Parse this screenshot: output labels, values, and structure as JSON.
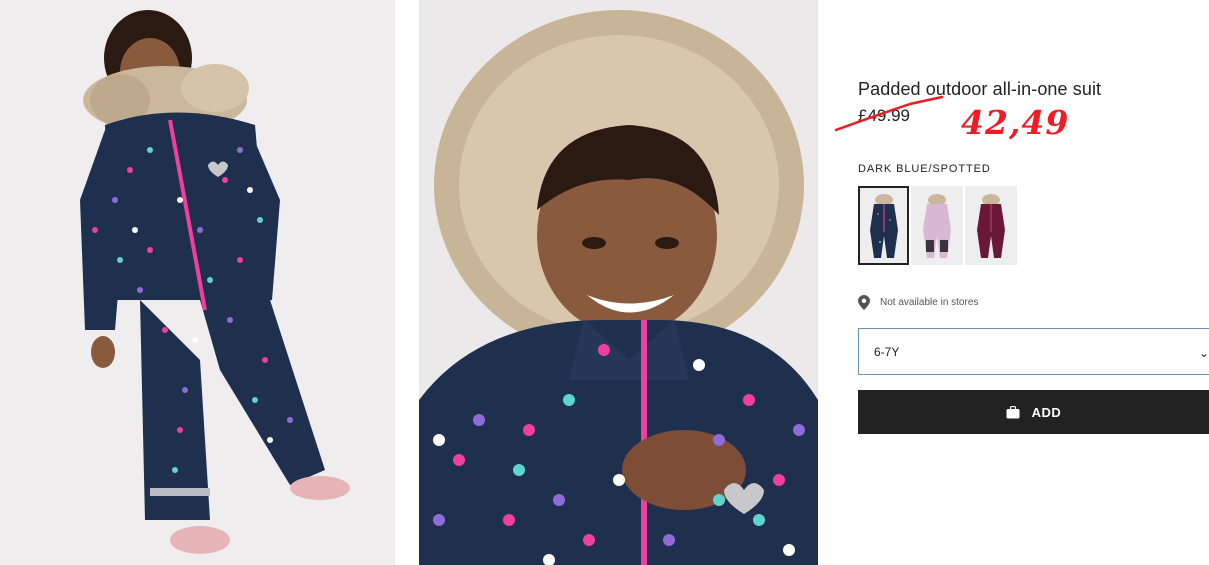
{
  "product": {
    "title": "Padded outdoor all-in-one suit",
    "old_price": "£49.99",
    "new_price": "42,49",
    "color_label": "DARK BLUE/SPOTTED",
    "colors": {
      "navy": "#1f2f4e",
      "pink_zip": "#f03fa0",
      "lilac": "#d9b8d3",
      "plum": "#6a1838",
      "fur": "#cbb79c",
      "annotation_red": "#ee1c24"
    },
    "swatches": [
      {
        "name": "dark blue/spotted",
        "selected": true
      },
      {
        "name": "light pink",
        "selected": false
      },
      {
        "name": "plum",
        "selected": false
      }
    ],
    "store_availability": "Not available in stores",
    "size": {
      "selected": "6-7Y"
    },
    "add_button_label": "ADD",
    "icons": {
      "location": "location-pin-icon",
      "chevron": "chevron-down-icon",
      "bag": "shopping-bag-icon"
    }
  }
}
